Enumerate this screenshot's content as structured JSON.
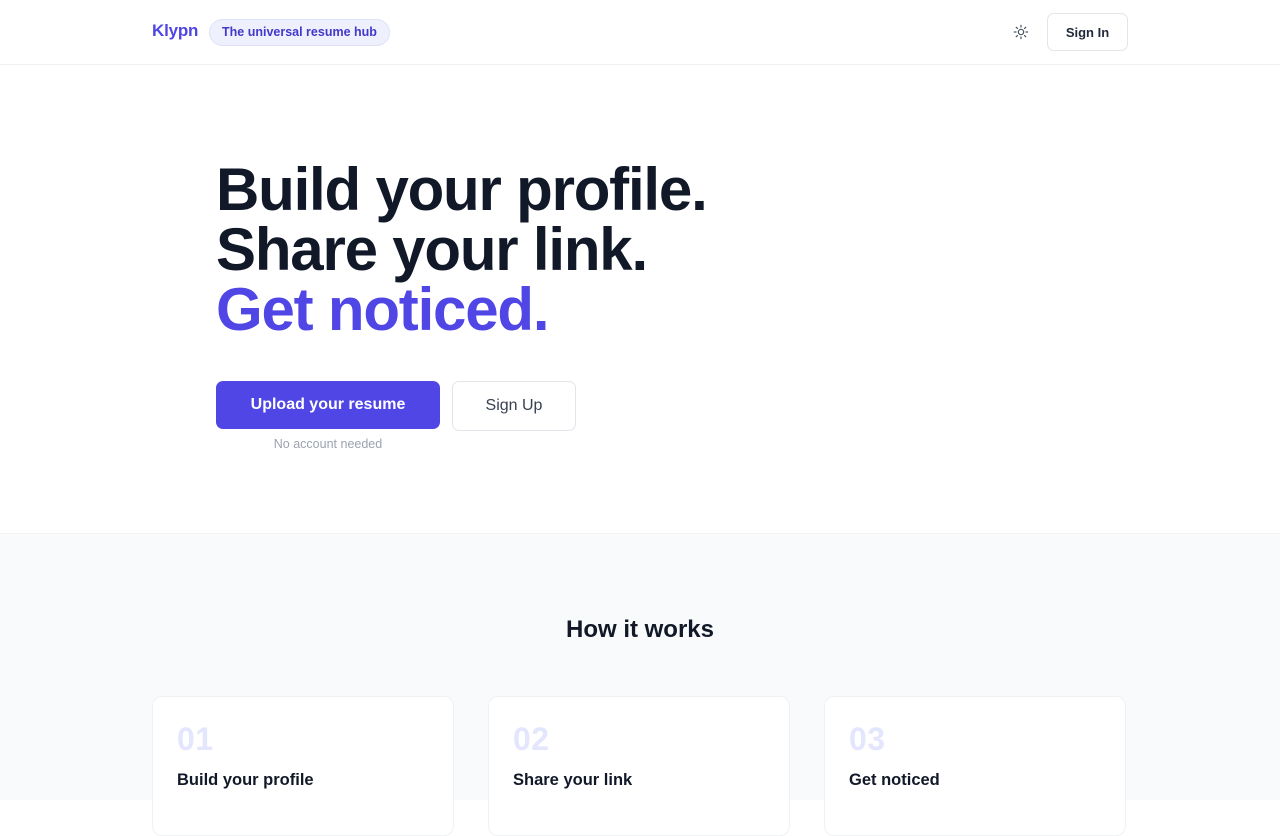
{
  "header": {
    "brand": "Klypn",
    "tagline": "The universal resume hub",
    "theme_icon": "sun-icon",
    "signin_label": "Sign In"
  },
  "hero": {
    "line1": "Build your profile.",
    "line2": "Share your link.",
    "line3": "Get noticed.",
    "primary_cta": "Upload your resume",
    "secondary_cta": "Sign Up",
    "hint": "No account needed"
  },
  "how": {
    "title": "How it works",
    "steps": [
      {
        "number": "01",
        "title": "Build your profile"
      },
      {
        "number": "02",
        "title": "Share your link"
      },
      {
        "number": "03",
        "title": "Get noticed"
      }
    ]
  },
  "colors": {
    "accent": "#4f46e5",
    "text": "#111827",
    "muted": "#9ca3af",
    "section_bg": "#f9fafb"
  }
}
